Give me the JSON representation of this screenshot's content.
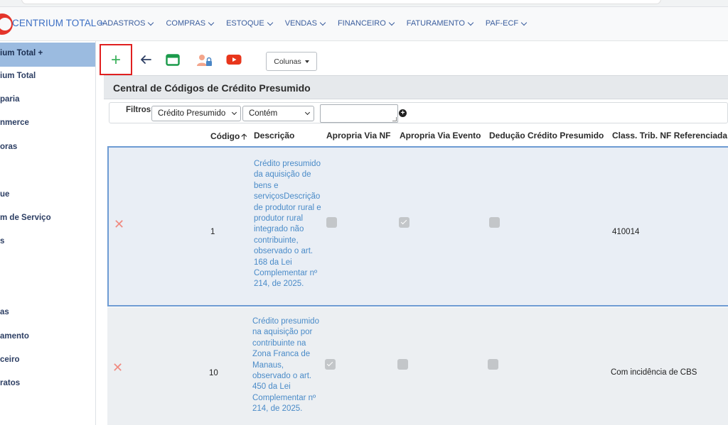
{
  "navbar": {
    "brand": "CENTRIUM TOTAL +",
    "menu": [
      "CADASTROS",
      "COMPRAS",
      "ESTOQUE",
      "VENDAS",
      "FINANCEIRO",
      "FATURAMENTO",
      "PAF-ECF"
    ]
  },
  "sidebar": {
    "items": [
      "ium Total +",
      "ium Total",
      "paria",
      "nmerce",
      "oras",
      "ue",
      "m de Serviço",
      "s",
      "as",
      "amento",
      "ceiro",
      "ratos"
    ],
    "active_index": 0
  },
  "toolbar": {
    "add_label": "+",
    "columns_label": "Colunas"
  },
  "panel": {
    "title": "Central de Códigos de Crédito Presumido"
  },
  "filters": {
    "label": "Filtros",
    "field": "Crédito Presumido",
    "operator": "Contém",
    "value": ""
  },
  "table": {
    "headers": {
      "codigo": "Código",
      "descricao": "Descrição",
      "apropria_nf": "Apropria Via NF",
      "apropria_evento": "Apropria Via Evento",
      "deducao": "Dedução Crédito Presumido",
      "class_trib": "Class. Trib. NF Referenciada"
    },
    "rows": [
      {
        "codigo": "1",
        "descricao": "Crédito presumido da aquisição de bens e serviçosDescrição de produtor rural e produtor rural integrado não contribuinte, observado o art. 168 da Lei Complementar nº 214, de 2025.",
        "apropria_nf": false,
        "apropria_evento": true,
        "deducao": false,
        "class_trib": "410014"
      },
      {
        "codigo": "10",
        "descricao": "Crédito presumido na aquisição por contribuinte na Zona Franca de Manaus, observado o art. 450 da Lei Complementar nº 214, de 2025.",
        "apropria_nf": true,
        "apropria_evento": false,
        "deducao": false,
        "class_trib": "Com incidência de CBS"
      }
    ]
  },
  "colors": {
    "accent": "#3b6fc4",
    "add_green": "#3ab15b",
    "highlight_red": "#e02020",
    "active_sidebar": "#9bbbe0",
    "link_blue": "#4a8bc8"
  }
}
